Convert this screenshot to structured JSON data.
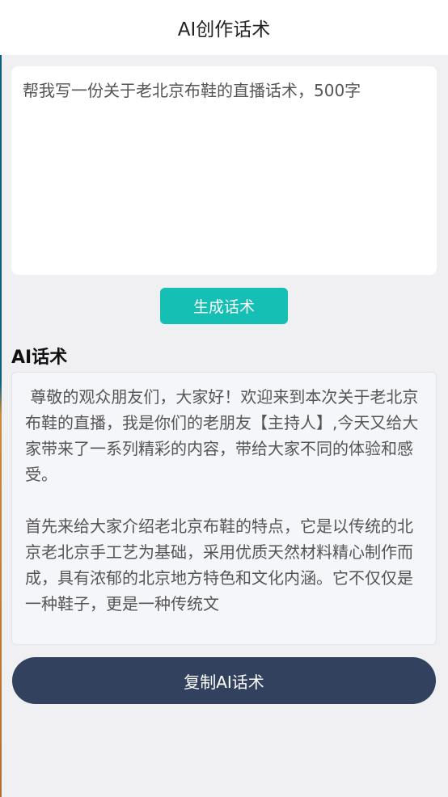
{
  "header": {
    "title": "AI创作话术"
  },
  "prompt": {
    "value": "帮我写一份关于老北京布鞋的直播话术，500字"
  },
  "actions": {
    "generate_label": "生成话术",
    "copy_label": "复制AI话术"
  },
  "result": {
    "title": "AI话术",
    "paragraphs": [
      " 尊敬的观众朋友们，大家好！欢迎来到本次关于老北京布鞋的直播，我是你们的老朋友【主持人】,今天又给大家带来了一系列精彩的内容，带给大家不同的体验和感受。",
      "首先来给大家介绍老北京布鞋的特点，它是以传统的北京老北京手工艺为基础，采用优质天然材料精心制作而成，具有浓郁的北京地方特色和文化内涵。它不仅仅是一种鞋子，更是一种传统文"
    ]
  }
}
